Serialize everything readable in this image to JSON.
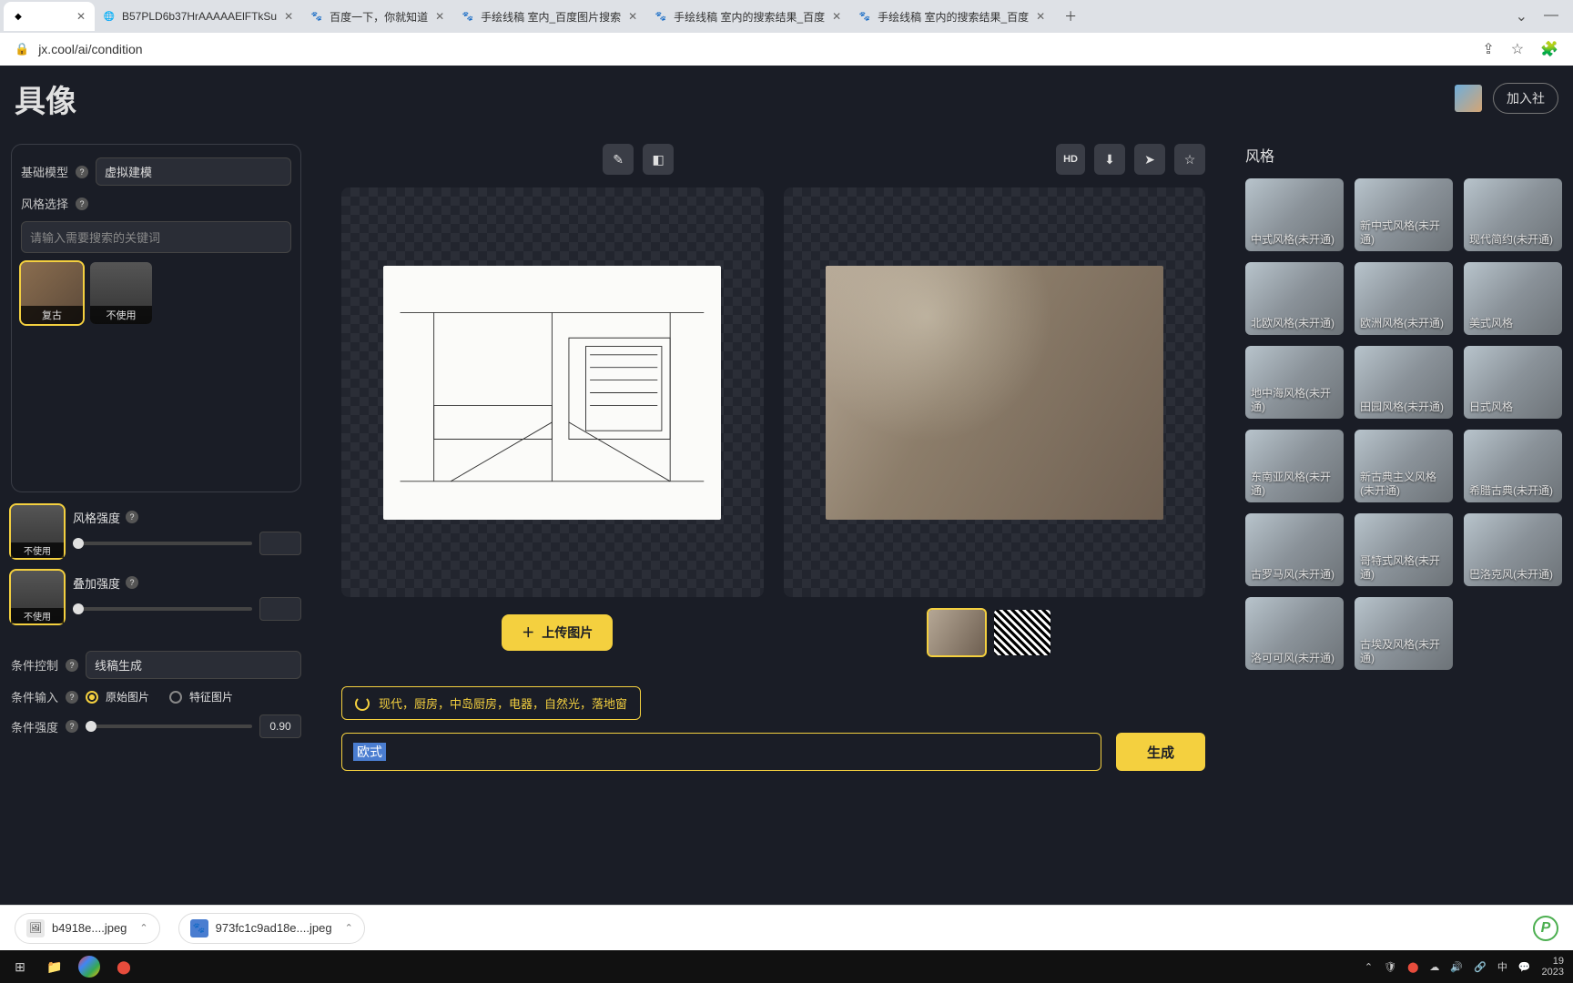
{
  "browser": {
    "tabs": [
      {
        "title": "",
        "active": true
      },
      {
        "title": "B57PLD6b37HrAAAAAElFTkSu"
      },
      {
        "title": "百度一下，你就知道"
      },
      {
        "title": "手绘线稿 室内_百度图片搜索"
      },
      {
        "title": "手绘线稿 室内的搜索结果_百度"
      },
      {
        "title": "手绘线稿 室内的搜索结果_百度"
      }
    ],
    "url": "jx.cool/ai/condition"
  },
  "header": {
    "brand": "具像",
    "join": "加入社"
  },
  "left": {
    "baseModel": {
      "label": "基础模型",
      "value": "虚拟建模"
    },
    "styleSelect": {
      "label": "风格选择"
    },
    "searchPlaceholder": "请输入需要搜索的关键词",
    "presets": [
      {
        "name": "复古",
        "selected": true
      },
      {
        "name": "不使用",
        "selected": false
      }
    ],
    "styleStrength": {
      "label": "风格强度",
      "thumb": "不使用"
    },
    "overlayStrength": {
      "label": "叠加强度",
      "thumb": "不使用"
    },
    "condControl": {
      "label": "条件控制",
      "value": "线稿生成"
    },
    "condInput": {
      "label": "条件输入",
      "opt1": "原始图片",
      "opt2": "特征图片"
    },
    "condWeight": {
      "label": "条件强度",
      "value": "0.90"
    }
  },
  "work": {
    "hd": "HD",
    "upload": "上传图片",
    "suggestion": "现代，厨房，中岛厨房，电器，自然光，落地窗",
    "prompt": "欧式",
    "generate": "生成"
  },
  "right": {
    "title": "风格",
    "styles": [
      "中式风格(未开通)",
      "新中式风格(未开通)",
      "现代简约(未开通)",
      "北欧风格(未开通)",
      "欧洲风格(未开通)",
      "美式风格",
      "地中海风格(未开通)",
      "田园风格(未开通)",
      "日式风格",
      "东南亚风格(未开通)",
      "新古典主义风格(未开通)",
      "希腊古典(未开通)",
      "古罗马风(未开通)",
      "哥特式风格(未开通)",
      "巴洛克风(未开通)",
      "洛可可风(未开通)",
      "古埃及风格(未开通)"
    ]
  },
  "downloads": {
    "items": [
      "b4918e....jpeg",
      "973fc1c9ad18e....jpeg"
    ]
  },
  "taskbar": {
    "ime": "中",
    "time": "19",
    "date": "2023"
  }
}
